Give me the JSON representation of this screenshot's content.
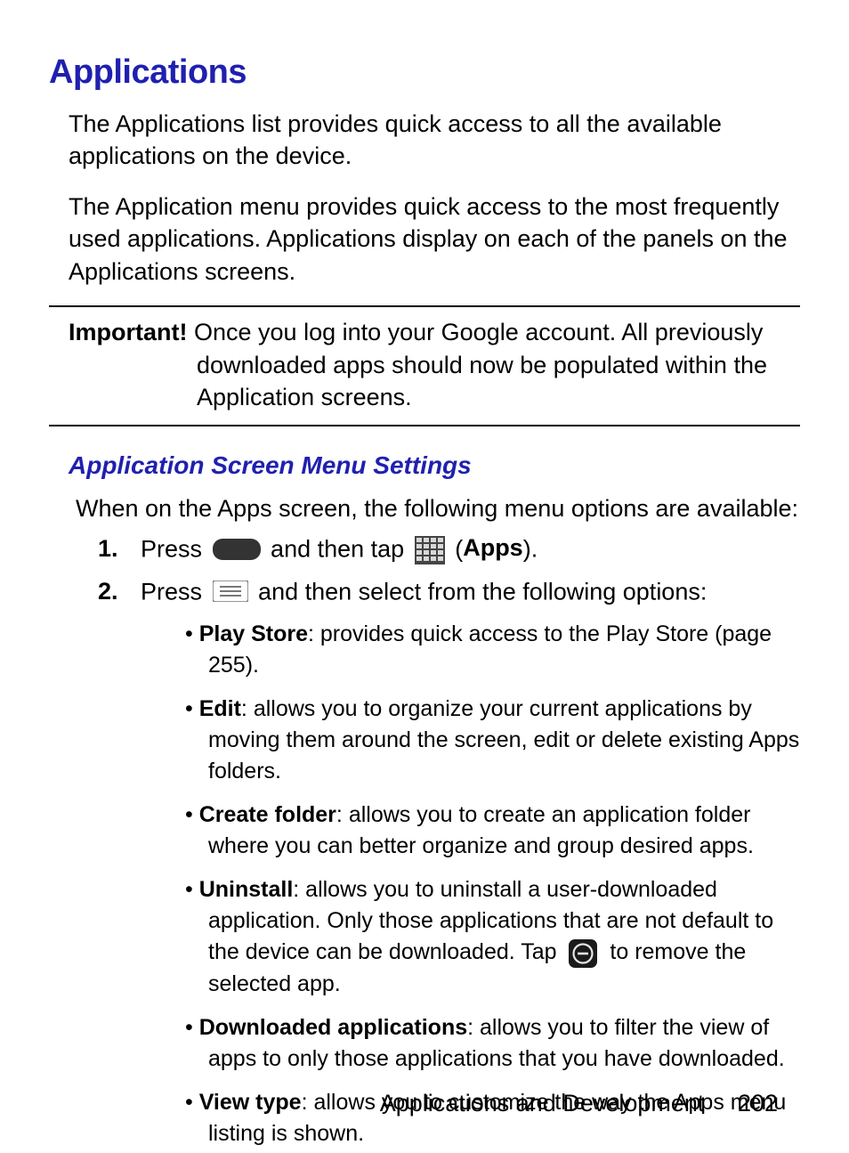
{
  "heading": "Applications",
  "intro1": "The Applications list provides quick access to all the available applications on the device.",
  "intro2": "The Application menu provides quick access to the most frequently used applications. Applications display on each of the panels on the Applications screens.",
  "important": {
    "label": "Important!",
    "text": "Once you log into your Google account. All previously downloaded apps should now be populated within the Application screens."
  },
  "subheading": "Application Screen Menu Settings",
  "subintro": "When on the Apps screen, the following menu options are available:",
  "steps": {
    "s1": {
      "num": "1.",
      "a": "Press ",
      "b": " and then tap ",
      "c": " (",
      "apps": "Apps",
      "d": ")."
    },
    "s2": {
      "num": "2.",
      "a": "Press ",
      "b": " and then select from the following options:"
    }
  },
  "options": {
    "o1": {
      "name": "Play Store",
      "text": ": provides quick access to the Play Store (page 255)."
    },
    "o2": {
      "name": "Edit",
      "text": ": allows you to organize your current applications by moving them around the screen, edit or delete existing Apps folders."
    },
    "o3": {
      "name": "Create folder",
      "text": ": allows you to create an application folder where you can better organize and group desired apps."
    },
    "o4": {
      "name": "Uninstall",
      "text_a": ": allows you to uninstall a user-downloaded application. Only those applications that are not default to the device can be downloaded. Tap ",
      "text_b": " to remove the selected app."
    },
    "o5": {
      "name": "Downloaded applications",
      "text": ": allows you to filter the view of apps to only those applications that you have downloaded."
    },
    "o6": {
      "name": "View type",
      "text": ": allows you to customize the way the Apps menu listing is shown."
    }
  },
  "footer": {
    "section": "Applications and Development",
    "page": "202"
  }
}
